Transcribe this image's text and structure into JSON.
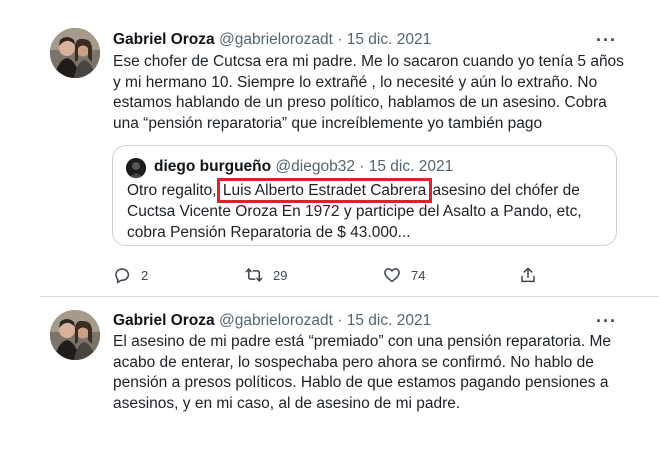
{
  "tweets": [
    {
      "author_name": "Gabriel Oroza",
      "handle": "@gabrielorozadt",
      "separator": "·",
      "date": "15 dic. 2021",
      "more": "···",
      "text": "Ese chofer de Cutcsa era mi padre. Me lo sacaron cuando yo tenía 5 años y mi hermano 10. Siempre lo extrañé , lo necesité y aún lo extraño. No estamos hablando de un preso político, hablamos de un asesino. Cobra una “pensión reparatoria” que increíblemente yo también pago",
      "quote": {
        "author_name": "diego burgueño",
        "handle": "@diegob32",
        "separator": "·",
        "date": "15 dic. 2021",
        "text_before": "Otro regalito, ",
        "highlighted_name": "Luis Alberto Estradet Cabrera",
        "text_after": " asesino del chófer de Cuctsa Vicente Oroza En 1972 y participe del Asalto a Pando, etc, cobra Pensión Reparatoria de $ 43.000..."
      },
      "actions": {
        "replies": "2",
        "retweets": "29",
        "likes": "74"
      }
    },
    {
      "author_name": "Gabriel Oroza",
      "handle": "@gabrielorozadt",
      "separator": "·",
      "date": "15 dic. 2021",
      "more": "···",
      "text": "El asesino de mi padre está “premiado” con una pensión reparatoria. Me acabo de enterar, lo sospechaba pero ahora se confirmó. No hablo de pensión a presos políticos. Hablo de que estamos pagando pensiones a asesinos, y en mi caso, al de asesino de mi padre."
    }
  ],
  "icons": {
    "reply": "reply-icon",
    "retweet": "retweet-icon",
    "like": "heart-icon",
    "share": "share-icon"
  },
  "colors": {
    "highlight_border": "#d9232b",
    "text": "#0f1419",
    "secondary_text": "#536471",
    "divider": "#d8dde1"
  }
}
